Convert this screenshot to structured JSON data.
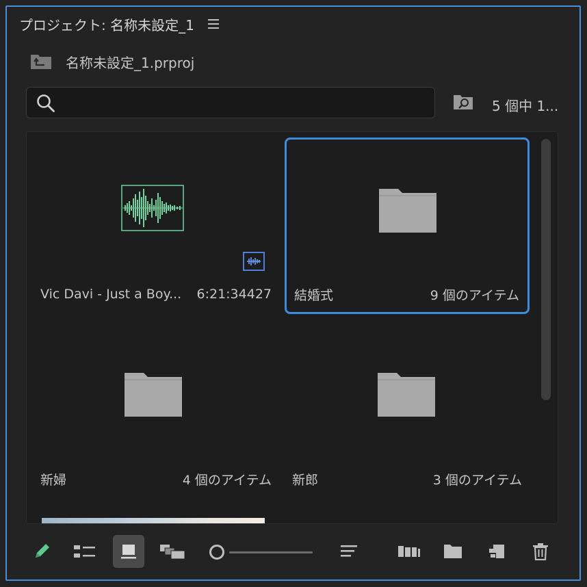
{
  "panel": {
    "title": "プロジェクト: 名称未設定_1",
    "menu_icon": "hamburger-menu-icon"
  },
  "project": {
    "file_name": "名称未設定_1.prproj",
    "icon": "project-folder-icon"
  },
  "search": {
    "value": "",
    "placeholder": "",
    "icon": "search-icon"
  },
  "find_icon": "find-bin-icon",
  "item_count": "5 個中 1...",
  "items": [
    {
      "kind": "audio",
      "name": "Vic Davi - Just a Boy...",
      "meta": "6:21:34427",
      "selected": false
    },
    {
      "kind": "bin",
      "name": "結婚式",
      "meta": "9 個のアイテム",
      "selected": true
    },
    {
      "kind": "bin",
      "name": "新婦",
      "meta": "4 個のアイテム",
      "selected": false
    },
    {
      "kind": "bin",
      "name": "新郎",
      "meta": "3 個のアイテム",
      "selected": false
    }
  ],
  "colors": {
    "accent": "#3d8cdd",
    "waveform": "#6fd5a0",
    "folder": "#a9a9a9",
    "audio_badge": "#4d7fd6"
  },
  "toolbar": {
    "buttons": [
      "pencil-icon",
      "list-view-icon",
      "icon-view-icon",
      "freeform-view-icon",
      "sort-icon",
      "automate-to-sequence-icon",
      "new-bin-icon",
      "new-item-icon",
      "trash-icon"
    ],
    "active_view": "icon-view",
    "zoom_level": 0
  }
}
